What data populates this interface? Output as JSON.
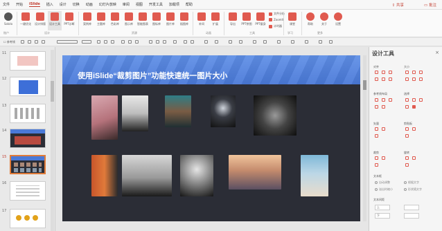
{
  "menu": {
    "items": [
      "文件",
      "开始",
      "iSlide",
      "插入",
      "设计",
      "切换",
      "动画",
      "幻灯片放映",
      "审阅",
      "视图",
      "开发工具",
      "加载项",
      "帮助"
    ],
    "active": "iSlide",
    "share": "共享",
    "comment": "批注"
  },
  "ribbon": {
    "buttons": [
      "Sololo",
      "一键优化",
      "设计排版",
      "设计工具",
      "PPT诊断",
      "案例库",
      "主题库",
      "色彩库",
      "图示库",
      "智能图表",
      "图标库",
      "图片库",
      "插图库",
      "补间",
      "扩展",
      "导出",
      "PPT拼图",
      "PPT瘦身",
      "课堂",
      "帮助",
      "关于",
      "设置"
    ],
    "small": [
      "文件分析",
      "ZoomIt",
      "计时器"
    ],
    "groups": [
      "账户",
      "设计",
      "资源",
      "动画",
      "工具",
      "学习",
      "更多"
    ]
  },
  "quickbar": {
    "placeholder_text": "参考线"
  },
  "slides": {
    "numbers": [
      "11",
      "12",
      "13",
      "14",
      "15",
      "16",
      "17"
    ],
    "selected": "15"
  },
  "slide": {
    "title": "使用iSlide“裁剪图片”功能快速统一图片大小"
  },
  "panel": {
    "title": "设计工具",
    "close": "×",
    "sections": {
      "align": "对齐",
      "size": "大小",
      "guides": "参考线布局",
      "select": "选择",
      "rotate": "矢量",
      "clipboard": "剪贴板",
      "crop": "裁剪",
      "rotate2": "旋转",
      "textbox": "文本框",
      "textspacing": "文本间距"
    },
    "radios": [
      "自动调整",
      "根据文字",
      "溢出时缩小",
      "形状随文字"
    ],
    "inputs": [
      "上",
      "下"
    ]
  }
}
